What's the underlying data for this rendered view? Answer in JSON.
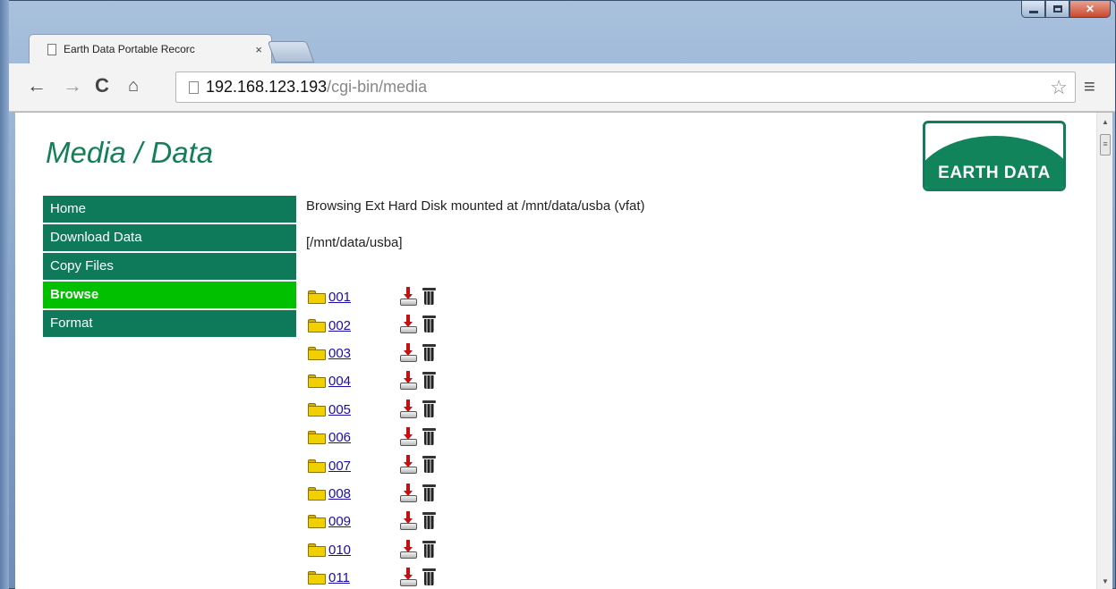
{
  "browser": {
    "tab_title": "Earth Data Portable Recorc",
    "tab_close": "×",
    "url_host": "192.168.123.193",
    "url_path": "/cgi-bin/media"
  },
  "page": {
    "title": "Media / Data",
    "logo_text": "EARTH DATA",
    "status": "Browsing Ext Hard Disk mounted at /mnt/data/usba (vfat)",
    "path": "[/mnt/data/usba]"
  },
  "sidebar": {
    "items": [
      {
        "label": "Home",
        "active": false
      },
      {
        "label": "Download Data",
        "active": false
      },
      {
        "label": "Copy Files",
        "active": false
      },
      {
        "label": "Browse",
        "active": true
      },
      {
        "label": "Format",
        "active": false
      }
    ]
  },
  "files": [
    "001",
    "002",
    "003",
    "004",
    "005",
    "006",
    "007",
    "008",
    "009",
    "010",
    "011"
  ],
  "colors": {
    "accent": "#0f7a5a",
    "active": "#00c000",
    "title": "#138058"
  }
}
